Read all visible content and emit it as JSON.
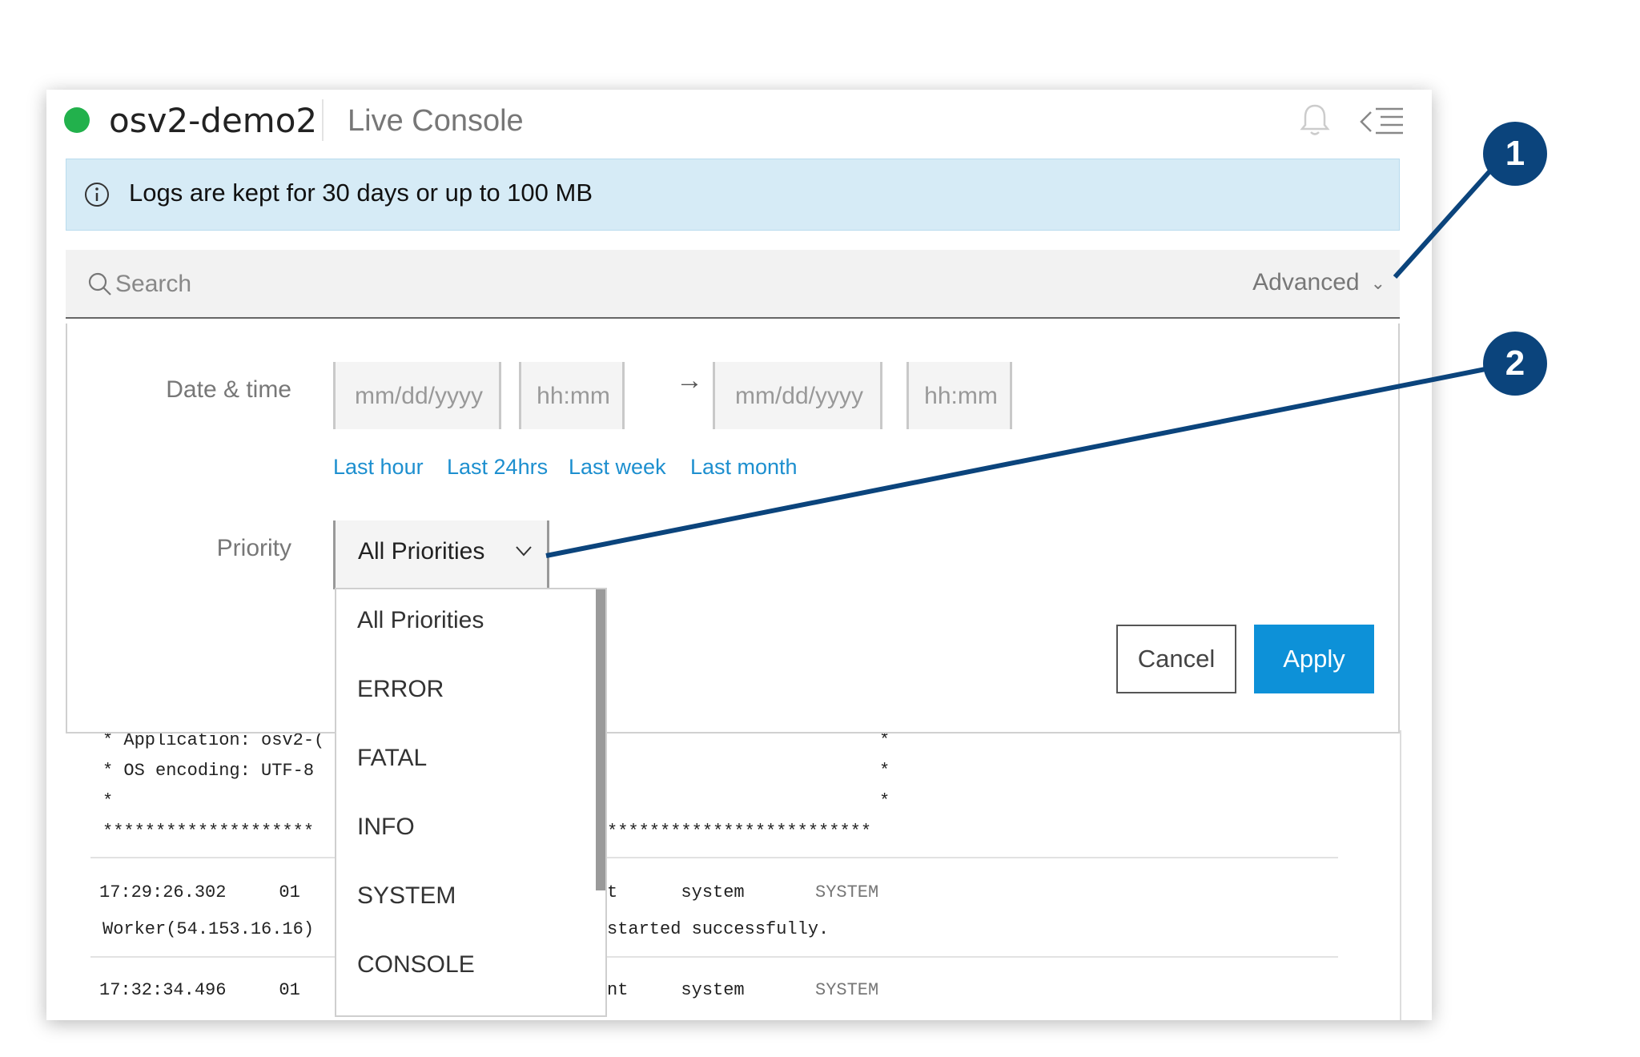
{
  "header": {
    "app_name": "osv2-demo2",
    "tab_title": "Live Console"
  },
  "banner": {
    "text": "Logs are kept for 30 days or up to 100 MB"
  },
  "search": {
    "placeholder": "Search",
    "advanced_label": "Advanced"
  },
  "filters": {
    "date_time_label": "Date & time",
    "start_date_placeholder": "mm/dd/yyyy",
    "start_time_placeholder": "hh:mm",
    "end_date_placeholder": "mm/dd/yyyy",
    "end_time_placeholder": "hh:mm",
    "range_arrow": "→",
    "quick_ranges": [
      "Last hour",
      "Last 24hrs",
      "Last week",
      "Last month"
    ],
    "priority_label": "Priority",
    "priority_selected": "All Priorities",
    "priority_options": [
      "All Priorities",
      "ERROR",
      "FATAL",
      "INFO",
      "SYSTEM",
      "CONSOLE"
    ]
  },
  "buttons": {
    "cancel": "Cancel",
    "apply": "Apply"
  },
  "log": {
    "lines": [
      "* Application: osv2-(",
      "* OS encoding: UTF-8",
      "*",
      "********************",
      "17:29:26.302     01",
      "Worker(54.153.16.16)",
      "17:32:34.496     01"
    ],
    "right_fragments": [
      "*",
      "*",
      "*",
      "*************************",
      "t      system     ",
      "started successfully.",
      "nt     system     "
    ],
    "sources": [
      "SYSTEM",
      "SYSTEM"
    ]
  },
  "callouts": [
    "1",
    "2"
  ],
  "colors": {
    "status": "#22b14c",
    "accent": "#0d91d8",
    "callout": "#0b447c",
    "banner": "#d6ebf6"
  }
}
